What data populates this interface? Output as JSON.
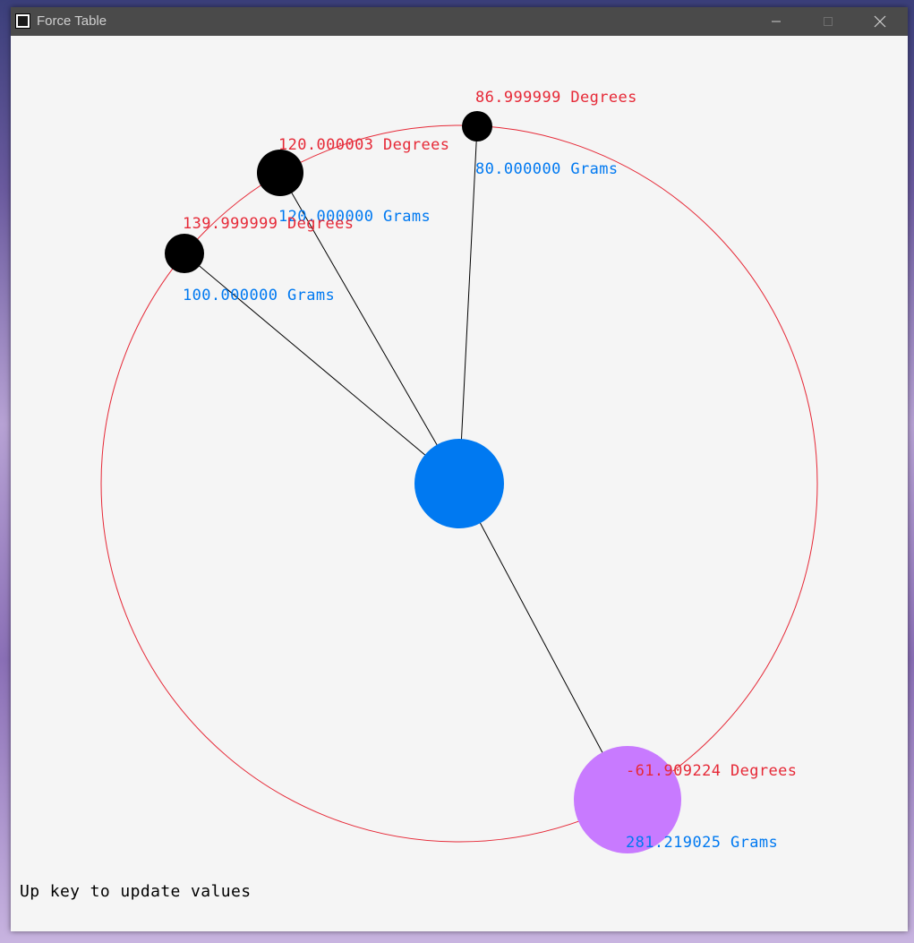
{
  "window": {
    "title": "Force Table",
    "icon_name": "raylib-app-icon",
    "controls": {
      "minimize_icon": "minimize-icon",
      "maximize_icon": "maximize-icon",
      "close_icon": "close-icon"
    }
  },
  "colors": {
    "degrees_text": "#e62937",
    "grams_text": "#0079f1",
    "center_ring": "#0079f1",
    "resultant_mass": "#c87aff",
    "masses": "#000000",
    "table_circle": "#e62937",
    "strings": "#000000"
  },
  "forces": [
    {
      "degrees_label": "86.999999 Degrees",
      "grams_label": "80.000000 Grams",
      "angle_deg": 86.999999,
      "grams": 80
    },
    {
      "degrees_label": "120.000003 Degrees",
      "grams_label": "120.000000 Grams",
      "angle_deg": 120.000003,
      "grams": 120
    },
    {
      "degrees_label": "139.999999 Degrees",
      "grams_label": "100.000000 Grams",
      "angle_deg": 139.999999,
      "grams": 100
    }
  ],
  "resultant": {
    "degrees_label": "-61.909224 Degrees",
    "grams_label": "281.219025 Grams",
    "angle_deg": -61.909224,
    "grams": 281.219025
  },
  "hint": "Up key to update values"
}
